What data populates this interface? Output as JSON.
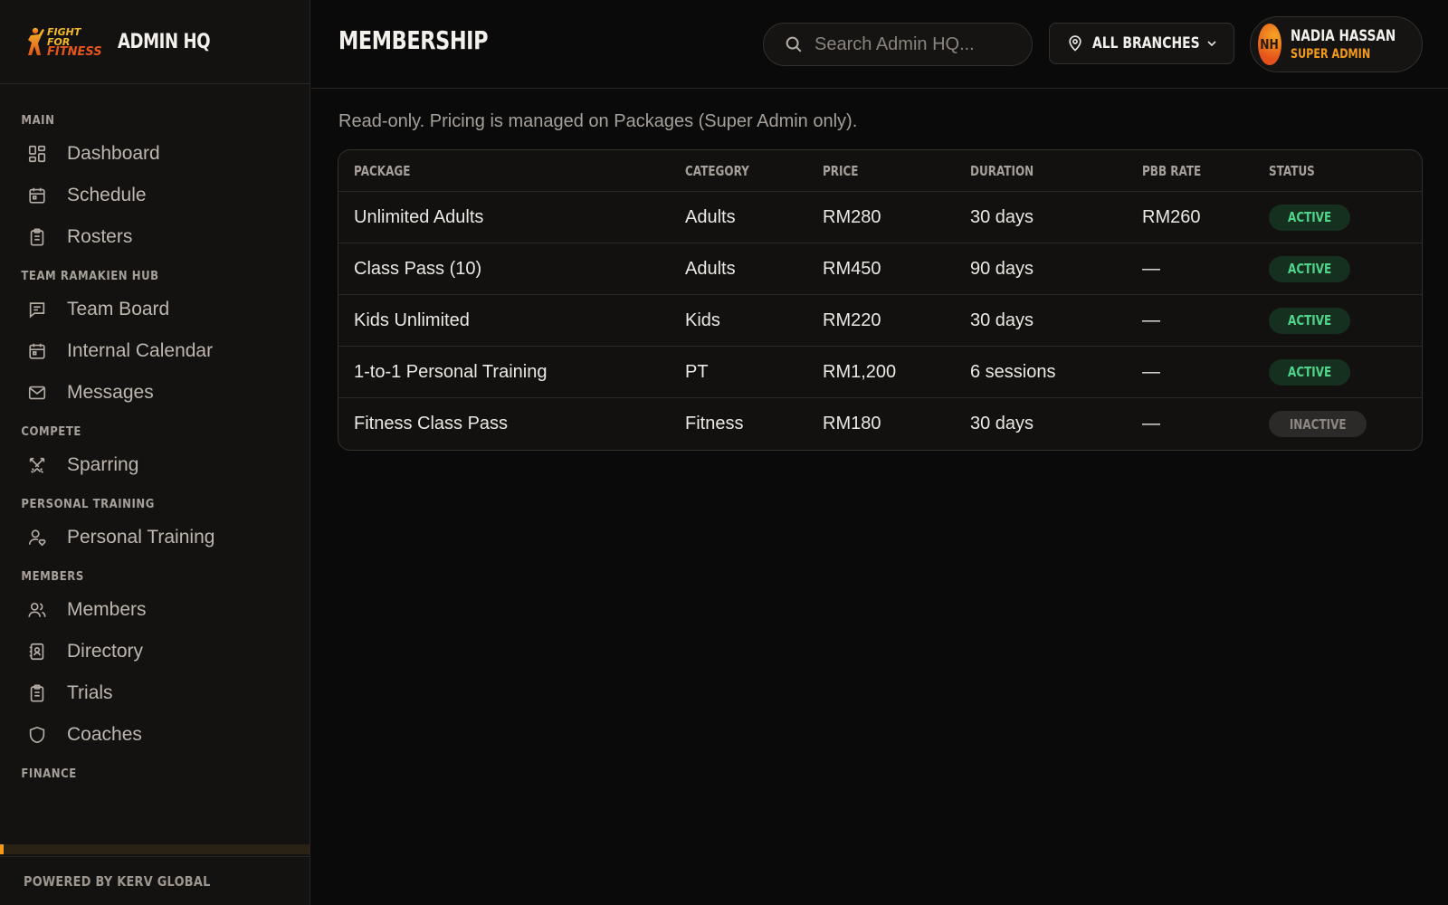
{
  "brand": {
    "logo_top": "FIGHT FOR",
    "logo_bottom": "FITNESS",
    "app_name": "ADMIN HQ"
  },
  "sidebar": {
    "sections": [
      {
        "title": "MAIN",
        "items": [
          {
            "label": "Dashboard",
            "icon": "dashboard-icon"
          },
          {
            "label": "Schedule",
            "icon": "calendar-icon"
          },
          {
            "label": "Rosters",
            "icon": "clipboard-icon"
          }
        ]
      },
      {
        "title": "TEAM RAMAKIEN HUB",
        "items": [
          {
            "label": "Team Board",
            "icon": "message-square-icon"
          },
          {
            "label": "Internal Calendar",
            "icon": "calendar-icon"
          },
          {
            "label": "Messages",
            "icon": "mail-icon"
          }
        ]
      },
      {
        "title": "COMPETE",
        "items": [
          {
            "label": "Sparring",
            "icon": "swords-icon"
          }
        ]
      },
      {
        "title": "PERSONAL TRAINING",
        "items": [
          {
            "label": "Personal Training",
            "icon": "user-heart-icon"
          }
        ]
      },
      {
        "title": "MEMBERS",
        "items": [
          {
            "label": "Members",
            "icon": "users-icon"
          },
          {
            "label": "Directory",
            "icon": "contact-book-icon"
          },
          {
            "label": "Trials",
            "icon": "clipboard-icon"
          },
          {
            "label": "Coaches",
            "icon": "shield-icon"
          }
        ]
      },
      {
        "title": "FINANCE",
        "items": []
      }
    ],
    "footer": "POWERED BY KERV GLOBAL"
  },
  "header": {
    "title": "MEMBERSHIP",
    "search_placeholder": "Search Admin HQ...",
    "branch_label": "ALL BRANCHES",
    "user": {
      "initials": "NH",
      "name": "NADIA HASSAN",
      "role": "SUPER ADMIN"
    }
  },
  "main": {
    "note": "Read-only. Pricing is managed on Packages (Super Admin only).",
    "table": {
      "columns": [
        "PACKAGE",
        "CATEGORY",
        "PRICE",
        "DURATION",
        "PBB RATE",
        "STATUS"
      ],
      "rows": [
        {
          "package": "Unlimited Adults",
          "category": "Adults",
          "price": "RM280",
          "duration": "30 days",
          "pbb_rate": "RM260",
          "status": "ACTIVE"
        },
        {
          "package": "Class Pass (10)",
          "category": "Adults",
          "price": "RM450",
          "duration": "90 days",
          "pbb_rate": "—",
          "status": "ACTIVE"
        },
        {
          "package": "Kids Unlimited",
          "category": "Kids",
          "price": "RM220",
          "duration": "30 days",
          "pbb_rate": "—",
          "status": "ACTIVE"
        },
        {
          "package": "1-to-1 Personal Training",
          "category": "PT",
          "price": "RM1,200",
          "duration": "6 sessions",
          "pbb_rate": "—",
          "status": "ACTIVE"
        },
        {
          "package": "Fitness Class Pass",
          "category": "Fitness",
          "price": "RM180",
          "duration": "30 days",
          "pbb_rate": "—",
          "status": "INACTIVE"
        }
      ]
    }
  },
  "colors": {
    "accent": "#f39a1c",
    "active": "#4fd48a",
    "inactive": "#8d8781",
    "background": "#0a0a0a",
    "sidebar": "#141211"
  }
}
